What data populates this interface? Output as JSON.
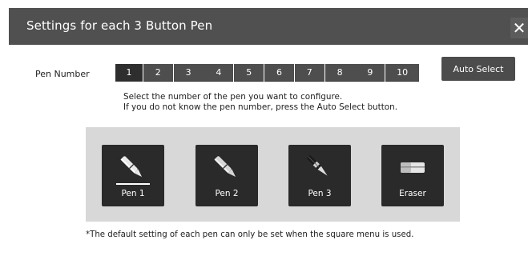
{
  "dialog": {
    "title": "Settings for each 3 Button Pen",
    "close_glyph": "✕"
  },
  "pen_number": {
    "label": "Pen Number",
    "numbers": [
      "1",
      "2",
      "3",
      "4",
      "5",
      "6",
      "7",
      "8",
      "9",
      "10"
    ],
    "selected": "1"
  },
  "auto_select": {
    "label": "Auto Select"
  },
  "instructions": {
    "line1": "Select the number of the pen you want to configure.",
    "line2": "If you do not know the pen number, press the Auto Select button."
  },
  "tiles": [
    {
      "label": "Pen 1",
      "icon": "pen-icon",
      "selected": true
    },
    {
      "label": "Pen 2",
      "icon": "pen-icon",
      "selected": false
    },
    {
      "label": "Pen 3",
      "icon": "pen-icon",
      "selected": false
    },
    {
      "label": "Eraser",
      "icon": "eraser-icon",
      "selected": false
    }
  ],
  "footnote": "*The default setting of each pen can only be set when the square menu is used.",
  "colors": {
    "titlebar": "#505050",
    "button": "#4e4e4e",
    "selected_button": "#2e2e2e",
    "panel": "#d8d8d8",
    "tile": "#2a2a2a"
  }
}
